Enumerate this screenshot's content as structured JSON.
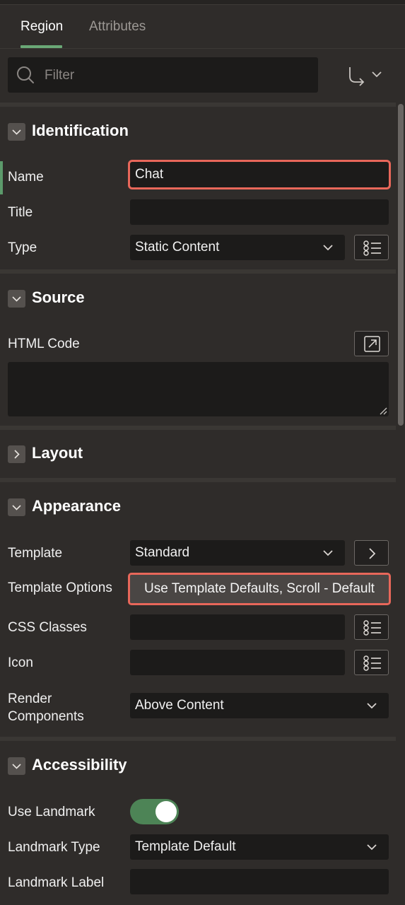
{
  "tabs": [
    {
      "label": "Region",
      "active": true
    },
    {
      "label": "Attributes",
      "active": false
    }
  ],
  "search": {
    "placeholder": "Filter",
    "value": ""
  },
  "toolbar": {
    "goto_icon": "go-to-group-icon"
  },
  "sections": {
    "identification": {
      "title": "Identification",
      "expanded": true,
      "name_label": "Name",
      "name_value": "Chat",
      "title_label": "Title",
      "title_value": "",
      "type_label": "Type",
      "type_value": "Static Content"
    },
    "source": {
      "title": "Source",
      "expanded": true,
      "html_code_label": "HTML Code",
      "html_code_value": ""
    },
    "layout": {
      "title": "Layout",
      "expanded": false
    },
    "appearance": {
      "title": "Appearance",
      "expanded": true,
      "template_label": "Template",
      "template_value": "Standard",
      "template_options_label": "Template Options",
      "template_options_value": "Use Template Defaults, Scroll - Default",
      "css_classes_label": "CSS Classes",
      "css_classes_value": "",
      "icon_label": "Icon",
      "icon_value": "",
      "render_components_label": "Render Components",
      "render_components_value": "Above Content"
    },
    "accessibility": {
      "title": "Accessibility",
      "expanded": true,
      "use_landmark_label": "Use Landmark",
      "use_landmark_on": true,
      "landmark_type_label": "Landmark Type",
      "landmark_type_value": "Template Default",
      "landmark_label_label": "Landmark Label",
      "landmark_label_value": ""
    }
  },
  "colors": {
    "background": "#2f2c2a",
    "field_bg": "#1c1b1a",
    "active_tab_underline": "#6aa876",
    "highlight_outline": "#e8675a",
    "toggle_on": "#4d8456"
  }
}
